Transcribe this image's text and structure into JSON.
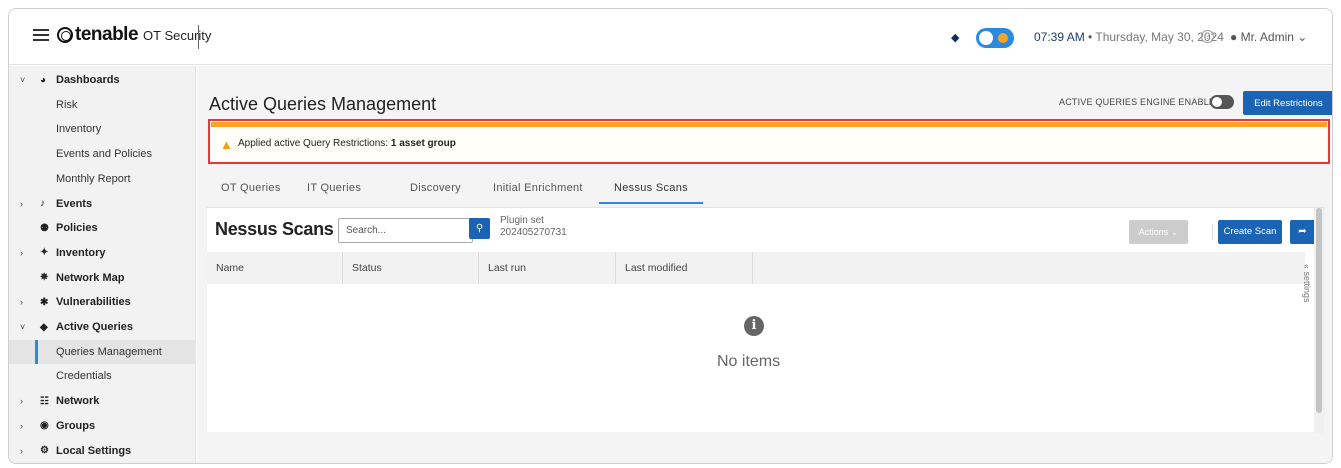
{
  "header": {
    "brand": "tenable",
    "product": "OT Security",
    "time": "07:39 AM",
    "date": "Thursday, May 30, 2024",
    "user": "Mr. Admin",
    "separator": "•"
  },
  "sidebar": {
    "items": [
      {
        "label": "Dashboards",
        "level": "top",
        "chevron": "down",
        "icon": "dashboard-icon"
      },
      {
        "label": "Risk",
        "level": "sub"
      },
      {
        "label": "Inventory",
        "level": "sub"
      },
      {
        "label": "Events and Policies",
        "level": "sub"
      },
      {
        "label": "Monthly Report",
        "level": "sub"
      },
      {
        "label": "Events",
        "level": "top",
        "chevron": "right",
        "icon": "bell-icon"
      },
      {
        "label": "Policies",
        "level": "top",
        "icon": "policy-icon"
      },
      {
        "label": "Inventory",
        "level": "top",
        "chevron": "right",
        "icon": "inventory-icon"
      },
      {
        "label": "Network Map",
        "level": "top",
        "icon": "network-map-icon"
      },
      {
        "label": "Vulnerabilities",
        "level": "top",
        "chevron": "right",
        "icon": "bug-icon"
      },
      {
        "label": "Active Queries",
        "level": "top",
        "chevron": "down",
        "icon": "shield-icon"
      },
      {
        "label": "Queries Management",
        "level": "sub",
        "active": true
      },
      {
        "label": "Credentials",
        "level": "sub"
      },
      {
        "label": "Network",
        "level": "top",
        "chevron": "right",
        "icon": "network-icon"
      },
      {
        "label": "Groups",
        "level": "top",
        "chevron": "right",
        "icon": "groups-icon"
      },
      {
        "label": "Local Settings",
        "level": "top",
        "chevron": "right",
        "icon": "settings-icon"
      }
    ]
  },
  "page": {
    "title": "Active Queries Management",
    "engine_label": "ACTIVE QUERIES ENGINE ENABLED",
    "edit_button": "Edit Restrictions"
  },
  "alert": {
    "prefix": "Applied active Query Restrictions:",
    "value": "1 asset group",
    "color": "#f5a623"
  },
  "tabs": [
    {
      "label": "OT Queries"
    },
    {
      "label": "IT Queries"
    },
    {
      "label": "Discovery"
    },
    {
      "label": "Initial Enrichment"
    },
    {
      "label": "Nessus Scans",
      "active": true
    }
  ],
  "section": {
    "title": "Nessus Scans",
    "search_placeholder": "Search...",
    "plugin_label": "Plugin set",
    "plugin_value": "202405270731",
    "actions_button": "Actions",
    "create_button": "Create Scan",
    "settings_label": "settings"
  },
  "table": {
    "columns": [
      "Name",
      "Status",
      "Last run",
      "Last modified"
    ],
    "empty_text": "No items"
  },
  "colors": {
    "primary": "#1b63b5",
    "accent": "#2b8ae0",
    "warning": "#f5a623",
    "highlight_box": "#e03a3a"
  }
}
